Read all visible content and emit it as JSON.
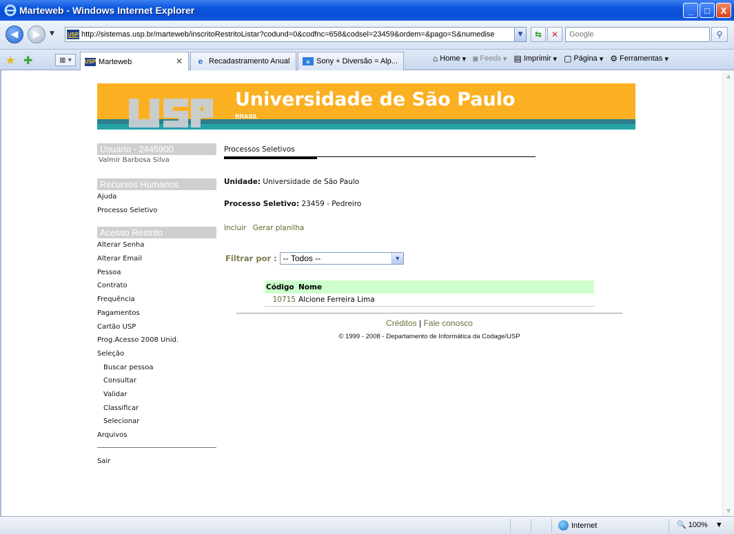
{
  "window": {
    "title": "Marteweb - Windows Internet Explorer",
    "minimize": "_",
    "maximize": "□",
    "close": "X"
  },
  "address": {
    "url": "http://sistemas.usp.br/marteweb/inscritoRestritoListar?codund=0&codfnc=658&codsel=23459&ordem=&pago=S&numedise",
    "favicon_text": "USP",
    "search_placeholder": "Google"
  },
  "tabs": [
    {
      "label": "Marteweb",
      "icon_text": "USP"
    },
    {
      "label": "Recadastramento Anual",
      "icon_text": "e"
    },
    {
      "label": "Sony + Diversão = Alp...",
      "icon_text": "u"
    }
  ],
  "commands": {
    "home": "Home",
    "feeds": "Feeds",
    "print": "Imprimir",
    "page": "Página",
    "tools": "Ferramentas"
  },
  "banner": {
    "title": "Universidade de São Paulo",
    "subtitle": "BRASIL",
    "colors": {
      "orange": "#fbb022",
      "teal": "#25a3a8",
      "dark_teal": "#2d7f8c"
    }
  },
  "sidebar": {
    "user_header": "Usuário - 2445900",
    "user_name": "Valmir Barbosa Silva",
    "rh_header": "Recursos Humanos",
    "rh_items": [
      "Ajuda",
      "Processo Seletivo"
    ],
    "restricted_header": "Acesso Restrito",
    "restricted_items": [
      {
        "label": "Alterar Senha",
        "sub": false
      },
      {
        "label": "Alterar Email",
        "sub": false
      },
      {
        "label": "Pessoa",
        "sub": false
      },
      {
        "label": "Contrato",
        "sub": false
      },
      {
        "label": "Frequência",
        "sub": false
      },
      {
        "label": "Pagamentos",
        "sub": false
      },
      {
        "label": "Cartão USP",
        "sub": false
      },
      {
        "label": "Prog.Acesso 2008 Unid.",
        "sub": false
      },
      {
        "label": "Seleção",
        "sub": false
      },
      {
        "label": "Buscar pessoa",
        "sub": true
      },
      {
        "label": "Consultar",
        "sub": true
      },
      {
        "label": "Validar",
        "sub": true
      },
      {
        "label": "Classificar",
        "sub": true
      },
      {
        "label": "Selecionar",
        "sub": true
      },
      {
        "label": "Arquivos",
        "sub": false
      }
    ],
    "logout": "Sair"
  },
  "main": {
    "section_title": "Processos Seletivos",
    "unidade_label": "Unidade:",
    "unidade_value": "Universidade de São Paulo",
    "processo_label": "Processo Seletivo:",
    "processo_value": "23459 - Pedreiro",
    "link_incluir": "Incluir",
    "link_planilha": "Gerar planilha",
    "filter_label": "Filtrar por :",
    "filter_value": "-- Todos --",
    "table": {
      "headers": [
        "Código",
        "Nome"
      ],
      "rows": [
        [
          "10715",
          "Alcione Ferreira Lima"
        ]
      ]
    }
  },
  "footer": {
    "credits": "Créditos",
    "separator": "|",
    "contact": "Fale conosco",
    "copyright": "© 1999 - 2008 - Departamento de Informática da Codage/USP"
  },
  "status": {
    "zone": "Internet",
    "zoom": "100%"
  }
}
